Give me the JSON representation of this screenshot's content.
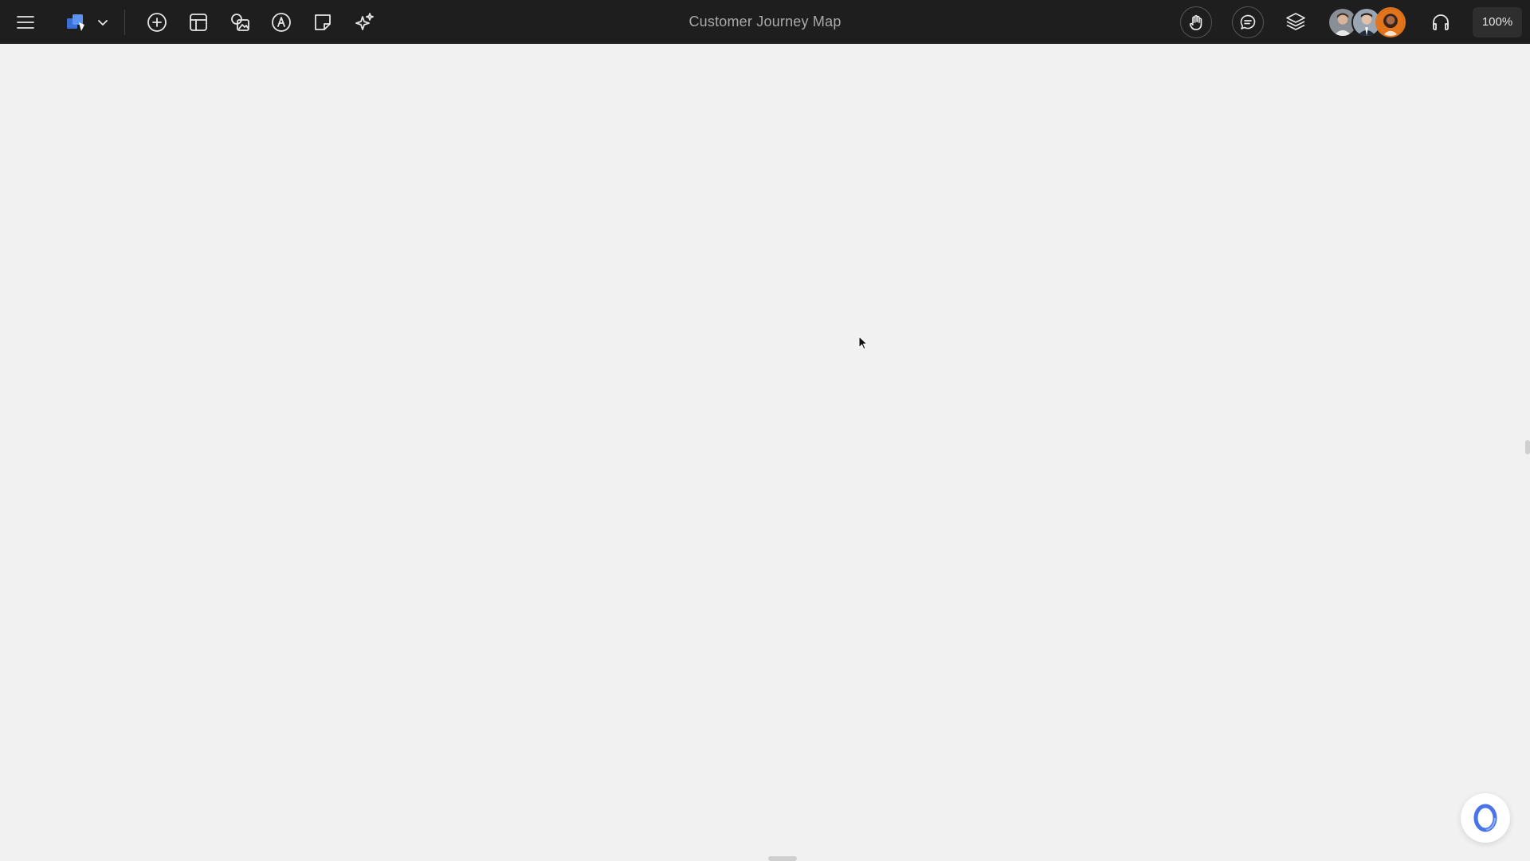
{
  "document": {
    "title": "Customer Journey Map"
  },
  "toolbar": {
    "left_icons": [
      "menu-icon",
      "board-logo-icon",
      "chevron-down-icon",
      "add-circle-icon",
      "template-icon",
      "image-shapes-icon",
      "pen-tool-icon",
      "sticky-note-icon",
      "ai-sparkle-icon"
    ],
    "right_icons": [
      "hand-icon",
      "comment-icon",
      "layers-icon",
      "headset-icon"
    ],
    "zoom_label": "100%"
  },
  "collaborators": {
    "count_visible": 3,
    "highlight_color": "#e2741b"
  },
  "colors": {
    "toolbar_bg": "#1e1e1e",
    "canvas_bg": "#f1f1f1",
    "brand_blue": "#2f7bf5",
    "assistant_accent": "#4a74e8"
  }
}
